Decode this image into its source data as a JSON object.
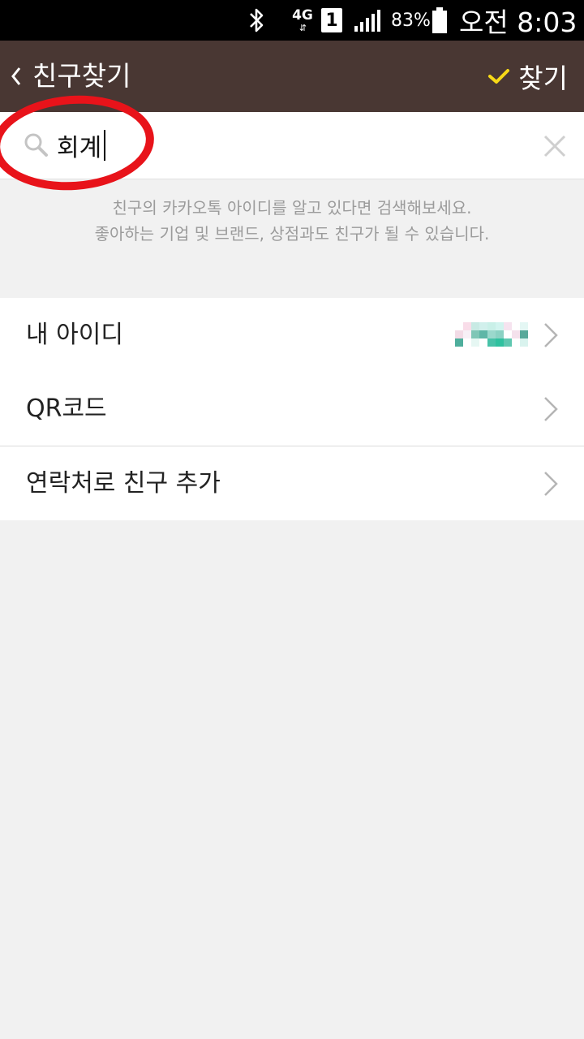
{
  "status_bar": {
    "network": "4G",
    "sim_slot": "1",
    "battery_percent": "83%",
    "time": "오전 8:03",
    "icons": [
      "bluetooth-icon",
      "network-arrows-icon",
      "signal-icon",
      "battery-icon"
    ]
  },
  "app_bar": {
    "title": "친구찾기",
    "confirm_label": "찾기",
    "accent_color": "#f7d917",
    "background_color": "#493733"
  },
  "search": {
    "value": "회계",
    "placeholder": ""
  },
  "hint": {
    "line1": "친구의 카카오톡 아이디를 알고 있다면 검색해보세요.",
    "line2": "좋아하는 기업 및 브랜드, 상점과도 친구가 될 수 있습니다."
  },
  "menu": {
    "items": [
      {
        "label": "내 아이디"
      },
      {
        "label": "QR코드"
      },
      {
        "label": "연락처로 친구 추가"
      }
    ]
  },
  "colors": {
    "annotation_circle": "#e8131a",
    "page_background": "#f1f1f1"
  }
}
